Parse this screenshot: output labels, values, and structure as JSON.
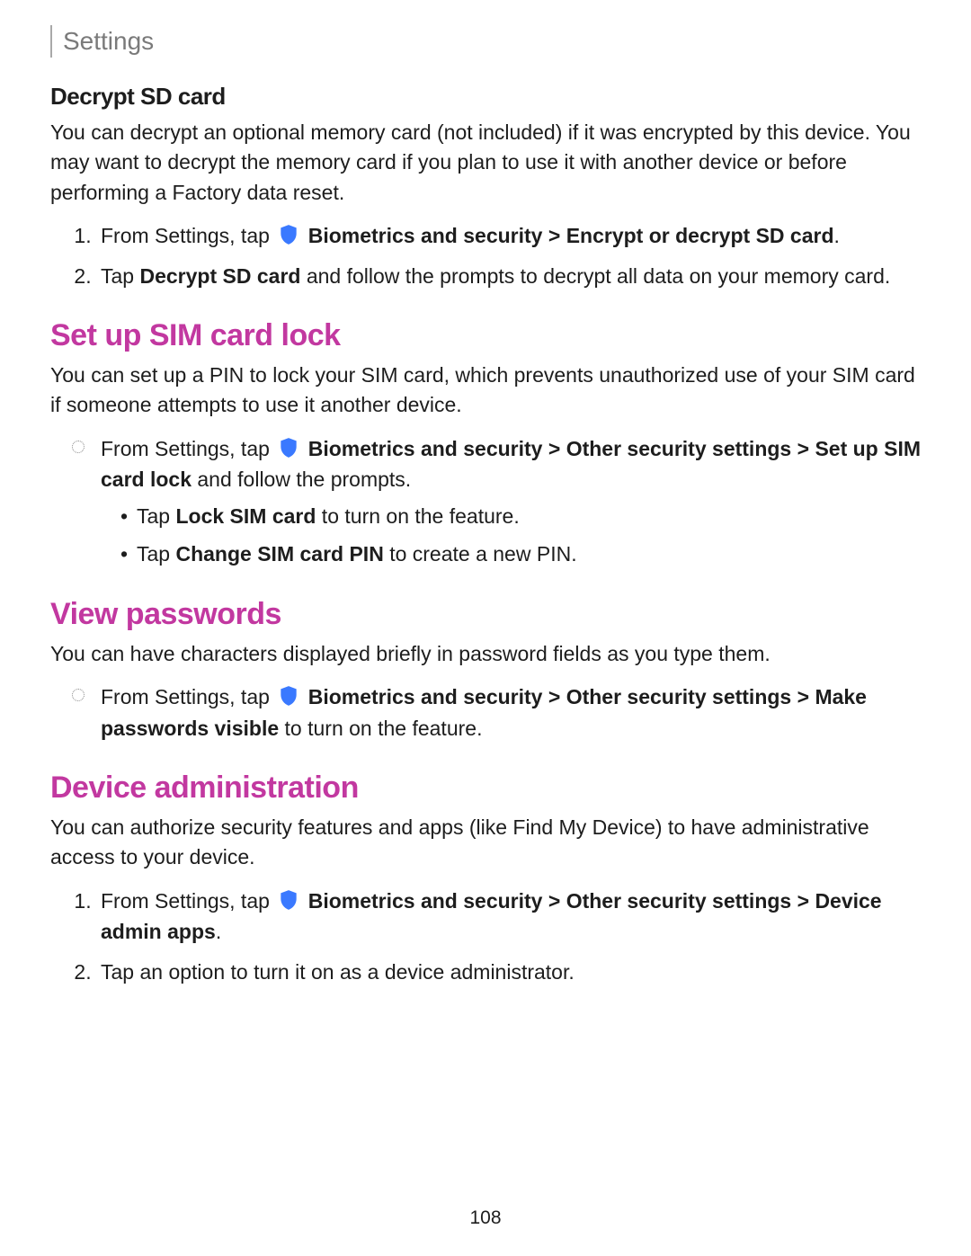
{
  "header": {
    "title": "Settings"
  },
  "page_number": "108",
  "icons": {
    "shield": "biometrics-security-shield-icon"
  },
  "shared": {
    "from_settings_tap": "From Settings, tap",
    "biometrics_label": " Biometrics and security",
    "other_security": "Other security settings",
    "chevron": " > "
  },
  "decrypt": {
    "heading": "Decrypt SD card",
    "intro": "You can decrypt an optional memory card (not included) if it was encrypted by this device. You may want to decrypt the memory card if you plan to use it with another device or before performing a Factory data reset.",
    "step1_path_end": "Encrypt or decrypt SD card",
    "step1_end": ".",
    "step2_a": "Tap ",
    "step2_bold": "Decrypt SD card",
    "step2_b": " and follow the prompts to decrypt all data on your memory card."
  },
  "sim": {
    "heading": "Set up SIM card lock",
    "intro": "You can set up a PIN to lock your SIM card, which prevents unauthorized use of your SIM card if someone attempts to use it another device.",
    "step1_path_end": "Set up SIM card lock",
    "step1_tail": " and follow the prompts.",
    "sub1_a": "Tap ",
    "sub1_bold": "Lock SIM card",
    "sub1_b": " to turn on the feature.",
    "sub2_a": "Tap ",
    "sub2_bold": "Change SIM card PIN",
    "sub2_b": " to create a new PIN."
  },
  "view_pw": {
    "heading": "View passwords",
    "intro": "You can have characters displayed briefly in password fields as you type them.",
    "step1_path_end": "Make passwords visible",
    "step1_tail": " to turn on the feature."
  },
  "device_admin": {
    "heading": "Device administration",
    "intro": "You can authorize security features and apps (like Find My Device) to have administrative access to your device.",
    "step1_path_end": "Device admin apps",
    "step1_tail": ".",
    "step2": "Tap an option to turn it on as a device administrator."
  }
}
